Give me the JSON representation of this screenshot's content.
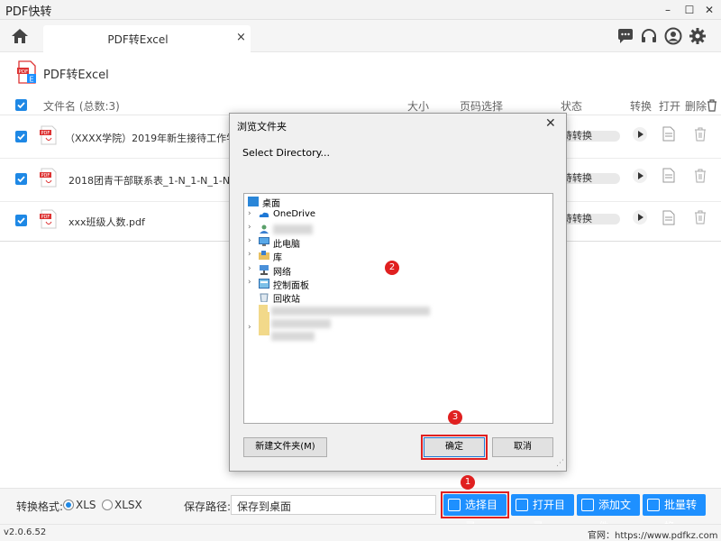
{
  "window": {
    "title": "PDF快转"
  },
  "tab": {
    "label": "PDF转Excel",
    "close": "×"
  },
  "page": {
    "title": "PDF转Excel"
  },
  "table": {
    "headers": {
      "name": "文件名 (总数:3)",
      "size": "大小",
      "pages": "页码选择",
      "status": "状态",
      "convert": "转换",
      "open": "打开",
      "delete": "删除"
    },
    "rows": [
      {
        "name": "（XXXX学院）2019年新生接待工作学生补",
        "status": "待转换"
      },
      {
        "name": "2018团青干部联系表_1-N_1-N_1-N.pdf",
        "status": "待转换"
      },
      {
        "name": "xxx班级人数.pdf",
        "status": "待转换"
      }
    ]
  },
  "bottom": {
    "format_label": "转换格式:",
    "opt_xls": "XLS",
    "opt_xlsx": "XLSX",
    "path_label": "保存路径:",
    "path_value": "保存到桌面",
    "btn_choose": "选择目录",
    "btn_open_dir": "打开目录",
    "btn_add": "添加文件",
    "btn_batch": "批量转换"
  },
  "status": {
    "version": "v2.0.6.52",
    "website": "官网：https://www.pdfkz.com"
  },
  "dialog": {
    "title": "浏览文件夹",
    "close": "✕",
    "prompt": "Select Directory...",
    "tree": [
      {
        "label": "桌面"
      },
      {
        "label": "OneDrive"
      },
      {
        "label": ""
      },
      {
        "label": "此电脑"
      },
      {
        "label": "库"
      },
      {
        "label": "网络"
      },
      {
        "label": "控制面板"
      },
      {
        "label": "回收站"
      }
    ],
    "btn_new": "新建文件夹(M)",
    "btn_ok": "确定",
    "btn_cancel": "取消"
  },
  "annotations": {
    "one": "1",
    "two": "2",
    "three": "3"
  },
  "colors": {
    "accent": "#1e90ff",
    "highlight": "#e02020"
  }
}
